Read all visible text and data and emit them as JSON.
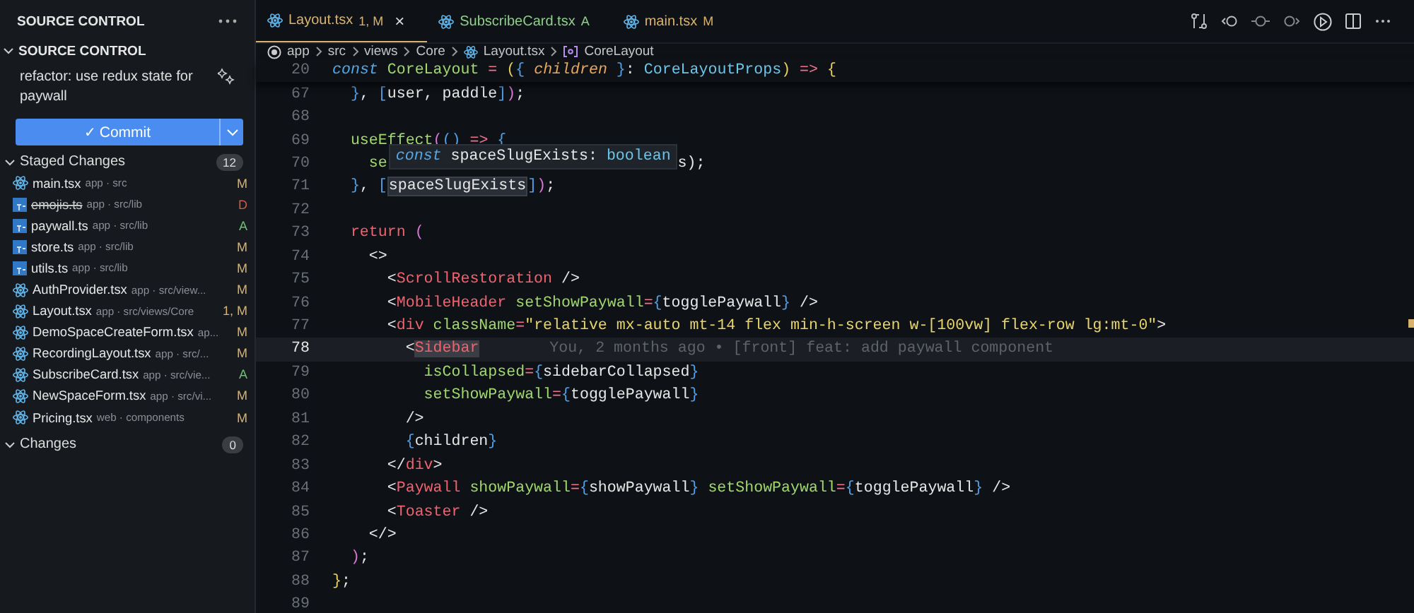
{
  "sidebar": {
    "title": "SOURCE CONTROL",
    "section": "SOURCE CONTROL",
    "section_expanded": true,
    "commit_message": "refactor: use redux state for paywall",
    "commit_button": "Commit",
    "commit_check": "✓",
    "groups": [
      {
        "label": "Staged Changes",
        "count": "12",
        "expanded": true,
        "files": [
          {
            "name": "main.tsx",
            "path": "app · src",
            "status": "M",
            "color": "#d9b36c",
            "kind": "react",
            "deleted": false
          },
          {
            "name": "emojis.ts",
            "path": "app · src/lib",
            "status": "D",
            "color": "#d05b4b",
            "kind": "ts",
            "deleted": true
          },
          {
            "name": "paywall.ts",
            "path": "app · src/lib",
            "status": "A",
            "color": "#6cc070",
            "kind": "ts",
            "deleted": false
          },
          {
            "name": "store.ts",
            "path": "app · src/lib",
            "status": "M",
            "color": "#d9b36c",
            "kind": "ts",
            "deleted": false
          },
          {
            "name": "utils.ts",
            "path": "app · src/lib",
            "status": "M",
            "color": "#d9b36c",
            "kind": "ts",
            "deleted": false
          },
          {
            "name": "AuthProvider.tsx",
            "path": "app · src/view...",
            "status": "M",
            "color": "#d9b36c",
            "kind": "react",
            "deleted": false
          },
          {
            "name": "Layout.tsx",
            "path": "app · src/views/Core",
            "status": "1, M",
            "color": "#d9b36c",
            "kind": "react",
            "deleted": false
          },
          {
            "name": "DemoSpaceCreateForm.tsx",
            "path": "ap...",
            "status": "M",
            "color": "#d9b36c",
            "kind": "react",
            "deleted": false
          },
          {
            "name": "RecordingLayout.tsx",
            "path": "app · src/...",
            "status": "M",
            "color": "#d9b36c",
            "kind": "react",
            "deleted": false
          },
          {
            "name": "SubscribeCard.tsx",
            "path": "app · src/vie...",
            "status": "A",
            "color": "#6cc070",
            "kind": "react",
            "deleted": false
          },
          {
            "name": "NewSpaceForm.tsx",
            "path": "app · src/vi...",
            "status": "M",
            "color": "#d9b36c",
            "kind": "react",
            "deleted": false
          },
          {
            "name": "Pricing.tsx",
            "path": "web · components",
            "status": "M",
            "color": "#d9b36c",
            "kind": "react",
            "deleted": false
          }
        ]
      },
      {
        "label": "Changes",
        "count": "0",
        "expanded": true
      }
    ]
  },
  "tabs": [
    {
      "name": "Layout.tsx",
      "status": "1, M",
      "color": "#d9b36c",
      "selected": true,
      "close": "×"
    },
    {
      "name": "SubscribeCard.tsx",
      "status": "A",
      "color": "#8fd08a",
      "selected": false
    },
    {
      "name": "main.tsx",
      "status": "M",
      "color": "#d9b36c",
      "selected": false
    }
  ],
  "breadcrumb": [
    {
      "text": "app",
      "kind": "circle"
    },
    {
      "text": "src"
    },
    {
      "text": "views"
    },
    {
      "text": "Core"
    },
    {
      "text": "Layout.tsx",
      "kind": "react"
    },
    {
      "text": "CoreLayout",
      "kind": "symbol"
    }
  ],
  "sticky_line": {
    "number": "20",
    "tokens": [
      {
        "kind": "kw",
        "text": "const "
      },
      {
        "kind": "fn",
        "text": "CoreLayout "
      },
      {
        "kind": "op",
        "text": "= "
      },
      {
        "kind": "paren",
        "text": "("
      },
      {
        "kind": "brace",
        "text": "{ "
      },
      {
        "kind": "param",
        "text": "children "
      },
      {
        "kind": "brace",
        "text": "}"
      },
      {
        "kind": "punct",
        "text": ": "
      },
      {
        "kind": "type",
        "text": "CoreLayoutProps"
      },
      {
        "kind": "paren",
        "text": ") "
      },
      {
        "kind": "op",
        "text": "=> "
      },
      {
        "kind": "paren",
        "text": "{"
      }
    ]
  },
  "lines": [
    {
      "number": "67",
      "current": false,
      "tokens": [
        {
          "kind": "brace",
          "text": "  }"
        },
        {
          "kind": "punct",
          "text": ", "
        },
        {
          "kind": "brace",
          "text": "["
        },
        {
          "kind": "plain",
          "text": "user, paddle"
        },
        {
          "kind": "brace",
          "text": "]"
        },
        {
          "kind": "paren2",
          "text": ")"
        },
        {
          "kind": "punct",
          "text": ";"
        }
      ]
    },
    {
      "number": "68",
      "current": false
    },
    {
      "number": "69",
      "current": false,
      "tokens": [
        {
          "kind": "fn",
          "text": "  useEffect"
        },
        {
          "kind": "paren2",
          "text": "("
        },
        {
          "kind": "brace",
          "text": "() "
        },
        {
          "kind": "op",
          "text": "=> "
        },
        {
          "kind": "brace",
          "text": "{"
        }
      ]
    },
    {
      "number": "70",
      "current": false,
      "tokens": [
        {
          "kind": "fn",
          "text": "    se"
        },
        {
          "kind": "tooltip",
          "tokens": [
            {
              "kind": "kw",
              "text": "const "
            },
            {
              "kind": "plain",
              "text": "spaceSlugExists"
            },
            {
              "kind": "punct",
              "text": ": "
            },
            {
              "kind": "type",
              "text": "boolean"
            }
          ]
        },
        {
          "kind": "plain",
          "text": "s);"
        }
      ]
    },
    {
      "number": "71",
      "current": false,
      "tokens": [
        {
          "kind": "brace",
          "text": "  }"
        },
        {
          "kind": "punct",
          "text": ", "
        },
        {
          "kind": "brace",
          "text": "["
        },
        {
          "kind": "mark",
          "text": "spaceSlugExists"
        },
        {
          "kind": "brace",
          "text": "]"
        },
        {
          "kind": "paren2",
          "text": ")"
        },
        {
          "kind": "punct",
          "text": ";"
        }
      ]
    },
    {
      "number": "72",
      "current": false
    },
    {
      "number": "73",
      "current": false,
      "tokens": [
        {
          "kind": "tag",
          "text": "  return "
        },
        {
          "kind": "paren2",
          "text": "("
        }
      ]
    },
    {
      "number": "74",
      "current": false,
      "tokens": [
        {
          "kind": "punct",
          "text": "    <>"
        }
      ]
    },
    {
      "number": "75",
      "current": false,
      "tokens": [
        {
          "kind": "punct",
          "text": "      <"
        },
        {
          "kind": "tag",
          "text": "ScrollRestoration"
        },
        {
          "kind": "punct",
          "text": " />"
        }
      ]
    },
    {
      "number": "76",
      "current": false,
      "tokens": [
        {
          "kind": "punct",
          "text": "      <"
        },
        {
          "kind": "tag",
          "text": "MobileHeader "
        },
        {
          "kind": "attr",
          "text": "setShowPaywall"
        },
        {
          "kind": "op",
          "text": "="
        },
        {
          "kind": "brace",
          "text": "{"
        },
        {
          "kind": "plain",
          "text": "togglePaywall"
        },
        {
          "kind": "brace",
          "text": "}"
        },
        {
          "kind": "punct",
          "text": " />"
        }
      ]
    },
    {
      "number": "77",
      "current": false,
      "tokens": [
        {
          "kind": "punct",
          "text": "      <"
        },
        {
          "kind": "tag",
          "text": "div "
        },
        {
          "kind": "attr",
          "text": "className"
        },
        {
          "kind": "op",
          "text": "="
        },
        {
          "kind": "str",
          "text": "\"relative mx-auto mt-14 flex min-h-screen w-[100vw] flex-row lg:mt-0\""
        },
        {
          "kind": "punct",
          "text": ">"
        }
      ]
    },
    {
      "number": "78",
      "current": true,
      "tokens": [
        {
          "kind": "punct",
          "text": "        <"
        },
        {
          "kind": "tagmark",
          "text": "Sidebar"
        }
      ],
      "blame": "You, 2 months ago • [front] feat: add paywall component"
    },
    {
      "number": "79",
      "current": false,
      "tokens": [
        {
          "kind": "attr",
          "text": "          isCollapsed"
        },
        {
          "kind": "op",
          "text": "="
        },
        {
          "kind": "brace",
          "text": "{"
        },
        {
          "kind": "plain",
          "text": "sidebarCollapsed"
        },
        {
          "kind": "brace",
          "text": "}"
        }
      ]
    },
    {
      "number": "80",
      "current": false,
      "tokens": [
        {
          "kind": "attr",
          "text": "          setShowPaywall"
        },
        {
          "kind": "op",
          "text": "="
        },
        {
          "kind": "brace",
          "text": "{"
        },
        {
          "kind": "plain",
          "text": "togglePaywall"
        },
        {
          "kind": "brace",
          "text": "}"
        }
      ]
    },
    {
      "number": "81",
      "current": false,
      "tokens": [
        {
          "kind": "punct",
          "text": "        />"
        }
      ]
    },
    {
      "number": "82",
      "current": false,
      "tokens": [
        {
          "kind": "brace",
          "text": "        {"
        },
        {
          "kind": "plain",
          "text": "children"
        },
        {
          "kind": "brace",
          "text": "}"
        }
      ]
    },
    {
      "number": "83",
      "current": false,
      "tokens": [
        {
          "kind": "punct",
          "text": "      </"
        },
        {
          "kind": "tag",
          "text": "div"
        },
        {
          "kind": "punct",
          "text": ">"
        }
      ]
    },
    {
      "number": "84",
      "current": false,
      "tokens": [
        {
          "kind": "punct",
          "text": "      <"
        },
        {
          "kind": "tag",
          "text": "Paywall "
        },
        {
          "kind": "attr",
          "text": "showPaywall"
        },
        {
          "kind": "op",
          "text": "="
        },
        {
          "kind": "brace",
          "text": "{"
        },
        {
          "kind": "plain",
          "text": "showPaywall"
        },
        {
          "kind": "brace",
          "text": "} "
        },
        {
          "kind": "attr",
          "text": "setShowPaywall"
        },
        {
          "kind": "op",
          "text": "="
        },
        {
          "kind": "brace",
          "text": "{"
        },
        {
          "kind": "plain",
          "text": "togglePaywall"
        },
        {
          "kind": "brace",
          "text": "}"
        },
        {
          "kind": "punct",
          "text": " />"
        }
      ]
    },
    {
      "number": "85",
      "current": false,
      "tokens": [
        {
          "kind": "punct",
          "text": "      <"
        },
        {
          "kind": "tag",
          "text": "Toaster"
        },
        {
          "kind": "punct",
          "text": " />"
        }
      ]
    },
    {
      "number": "86",
      "current": false,
      "tokens": [
        {
          "kind": "punct",
          "text": "    </>"
        }
      ]
    },
    {
      "number": "87",
      "current": false,
      "tokens": [
        {
          "kind": "paren2",
          "text": "  )"
        },
        {
          "kind": "punct",
          "text": ";"
        }
      ]
    },
    {
      "number": "88",
      "current": false,
      "tokens": [
        {
          "kind": "paren",
          "text": "}"
        },
        {
          "kind": "punct",
          "text": ";"
        }
      ]
    },
    {
      "number": "89",
      "current": false
    }
  ]
}
